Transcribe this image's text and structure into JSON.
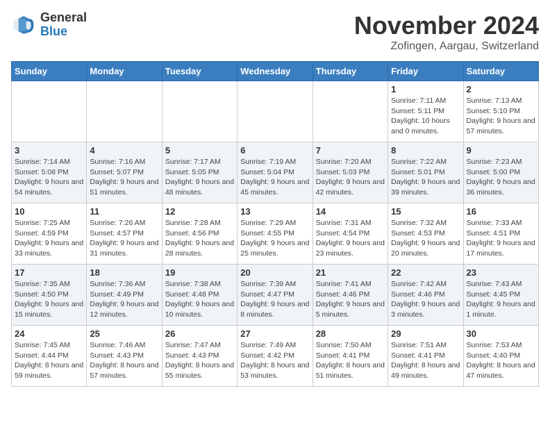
{
  "logo": {
    "general": "General",
    "blue": "Blue"
  },
  "title": "November 2024",
  "subtitle": "Zofingen, Aargau, Switzerland",
  "days_of_week": [
    "Sunday",
    "Monday",
    "Tuesday",
    "Wednesday",
    "Thursday",
    "Friday",
    "Saturday"
  ],
  "weeks": [
    [
      {
        "day": "",
        "sunrise": "",
        "sunset": "",
        "daylight": ""
      },
      {
        "day": "",
        "sunrise": "",
        "sunset": "",
        "daylight": ""
      },
      {
        "day": "",
        "sunrise": "",
        "sunset": "",
        "daylight": ""
      },
      {
        "day": "",
        "sunrise": "",
        "sunset": "",
        "daylight": ""
      },
      {
        "day": "",
        "sunrise": "",
        "sunset": "",
        "daylight": ""
      },
      {
        "day": "1",
        "sunrise": "Sunrise: 7:11 AM",
        "sunset": "Sunset: 5:11 PM",
        "daylight": "Daylight: 10 hours and 0 minutes."
      },
      {
        "day": "2",
        "sunrise": "Sunrise: 7:13 AM",
        "sunset": "Sunset: 5:10 PM",
        "daylight": "Daylight: 9 hours and 57 minutes."
      }
    ],
    [
      {
        "day": "3",
        "sunrise": "Sunrise: 7:14 AM",
        "sunset": "Sunset: 5:08 PM",
        "daylight": "Daylight: 9 hours and 54 minutes."
      },
      {
        "day": "4",
        "sunrise": "Sunrise: 7:16 AM",
        "sunset": "Sunset: 5:07 PM",
        "daylight": "Daylight: 9 hours and 51 minutes."
      },
      {
        "day": "5",
        "sunrise": "Sunrise: 7:17 AM",
        "sunset": "Sunset: 5:05 PM",
        "daylight": "Daylight: 9 hours and 48 minutes."
      },
      {
        "day": "6",
        "sunrise": "Sunrise: 7:19 AM",
        "sunset": "Sunset: 5:04 PM",
        "daylight": "Daylight: 9 hours and 45 minutes."
      },
      {
        "day": "7",
        "sunrise": "Sunrise: 7:20 AM",
        "sunset": "Sunset: 5:03 PM",
        "daylight": "Daylight: 9 hours and 42 minutes."
      },
      {
        "day": "8",
        "sunrise": "Sunrise: 7:22 AM",
        "sunset": "Sunset: 5:01 PM",
        "daylight": "Daylight: 9 hours and 39 minutes."
      },
      {
        "day": "9",
        "sunrise": "Sunrise: 7:23 AM",
        "sunset": "Sunset: 5:00 PM",
        "daylight": "Daylight: 9 hours and 36 minutes."
      }
    ],
    [
      {
        "day": "10",
        "sunrise": "Sunrise: 7:25 AM",
        "sunset": "Sunset: 4:59 PM",
        "daylight": "Daylight: 9 hours and 33 minutes."
      },
      {
        "day": "11",
        "sunrise": "Sunrise: 7:26 AM",
        "sunset": "Sunset: 4:57 PM",
        "daylight": "Daylight: 9 hours and 31 minutes."
      },
      {
        "day": "12",
        "sunrise": "Sunrise: 7:28 AM",
        "sunset": "Sunset: 4:56 PM",
        "daylight": "Daylight: 9 hours and 28 minutes."
      },
      {
        "day": "13",
        "sunrise": "Sunrise: 7:29 AM",
        "sunset": "Sunset: 4:55 PM",
        "daylight": "Daylight: 9 hours and 25 minutes."
      },
      {
        "day": "14",
        "sunrise": "Sunrise: 7:31 AM",
        "sunset": "Sunset: 4:54 PM",
        "daylight": "Daylight: 9 hours and 23 minutes."
      },
      {
        "day": "15",
        "sunrise": "Sunrise: 7:32 AM",
        "sunset": "Sunset: 4:53 PM",
        "daylight": "Daylight: 9 hours and 20 minutes."
      },
      {
        "day": "16",
        "sunrise": "Sunrise: 7:33 AM",
        "sunset": "Sunset: 4:51 PM",
        "daylight": "Daylight: 9 hours and 17 minutes."
      }
    ],
    [
      {
        "day": "17",
        "sunrise": "Sunrise: 7:35 AM",
        "sunset": "Sunset: 4:50 PM",
        "daylight": "Daylight: 9 hours and 15 minutes."
      },
      {
        "day": "18",
        "sunrise": "Sunrise: 7:36 AM",
        "sunset": "Sunset: 4:49 PM",
        "daylight": "Daylight: 9 hours and 12 minutes."
      },
      {
        "day": "19",
        "sunrise": "Sunrise: 7:38 AM",
        "sunset": "Sunset: 4:48 PM",
        "daylight": "Daylight: 9 hours and 10 minutes."
      },
      {
        "day": "20",
        "sunrise": "Sunrise: 7:39 AM",
        "sunset": "Sunset: 4:47 PM",
        "daylight": "Daylight: 9 hours and 8 minutes."
      },
      {
        "day": "21",
        "sunrise": "Sunrise: 7:41 AM",
        "sunset": "Sunset: 4:46 PM",
        "daylight": "Daylight: 9 hours and 5 minutes."
      },
      {
        "day": "22",
        "sunrise": "Sunrise: 7:42 AM",
        "sunset": "Sunset: 4:46 PM",
        "daylight": "Daylight: 9 hours and 3 minutes."
      },
      {
        "day": "23",
        "sunrise": "Sunrise: 7:43 AM",
        "sunset": "Sunset: 4:45 PM",
        "daylight": "Daylight: 9 hours and 1 minute."
      }
    ],
    [
      {
        "day": "24",
        "sunrise": "Sunrise: 7:45 AM",
        "sunset": "Sunset: 4:44 PM",
        "daylight": "Daylight: 8 hours and 59 minutes."
      },
      {
        "day": "25",
        "sunrise": "Sunrise: 7:46 AM",
        "sunset": "Sunset: 4:43 PM",
        "daylight": "Daylight: 8 hours and 57 minutes."
      },
      {
        "day": "26",
        "sunrise": "Sunrise: 7:47 AM",
        "sunset": "Sunset: 4:43 PM",
        "daylight": "Daylight: 8 hours and 55 minutes."
      },
      {
        "day": "27",
        "sunrise": "Sunrise: 7:49 AM",
        "sunset": "Sunset: 4:42 PM",
        "daylight": "Daylight: 8 hours and 53 minutes."
      },
      {
        "day": "28",
        "sunrise": "Sunrise: 7:50 AM",
        "sunset": "Sunset: 4:41 PM",
        "daylight": "Daylight: 8 hours and 51 minutes."
      },
      {
        "day": "29",
        "sunrise": "Sunrise: 7:51 AM",
        "sunset": "Sunset: 4:41 PM",
        "daylight": "Daylight: 8 hours and 49 minutes."
      },
      {
        "day": "30",
        "sunrise": "Sunrise: 7:53 AM",
        "sunset": "Sunset: 4:40 PM",
        "daylight": "Daylight: 8 hours and 47 minutes."
      }
    ]
  ]
}
